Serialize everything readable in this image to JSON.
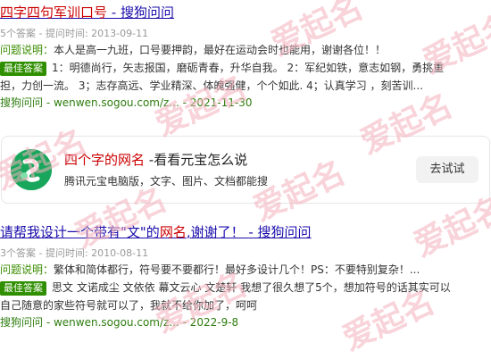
{
  "result1": {
    "title_main": "四字四句军训口号",
    "title_suffix": " - 搜狗问问",
    "meta": "5个答案 - 提问时间: 2013-09-11",
    "question_label": "问题说明：",
    "question_text": "本人是高一九班，口号要押韵，最好在运动会时也能用，谢谢各位！！",
    "best_label": "最佳答案",
    "answer_line1": "1：明德尚行，矢志报国，磨砺青春，升华自我。 2：军纪如铁，意志如钢，勇挑重",
    "answer_line2": "担，力创一流。 3；志存高远、学业精深、体魄强健，个个如此. 4；认真学习 ，刻苦训...",
    "url": "搜狗问问 - wenwen.sogou.com/z... - 2021-11-30"
  },
  "card": {
    "title_hl": "四个字的网名",
    "title_rest": " -看看元宝怎么说",
    "subtitle": "腾讯元宝电脑版，文字、图片、文档都能搜",
    "button": "去试试"
  },
  "result2": {
    "title_a": "请帮我设计一个带有\"文\"的",
    "title_hl": "网名",
    "title_b": ",谢谢了！ - 搜狗问问",
    "meta": "3个答案 - 提问时间: 2010-08-11",
    "question_label": "问题说明：",
    "question_text": "繁体和简体都行，符号要不要都行！最好多设计几个！PS：不要特别复杂！...",
    "best_label": "最佳答案",
    "answer_line1": "思文 文诺成尘 文依依 幕文云心 文楚轩 我想了很久想了5个，想加符号的话其实可以",
    "answer_line2": "自己随意的家些符号就可以了，我就不给你加了，呵呵",
    "url": "搜狗问问 - wenwen.sogou.com/z... - 2022-9-8"
  },
  "watermark": "爱起名",
  "colors": {
    "link": "#1a0dab",
    "highlight": "#c00000",
    "green": "#2f8f00",
    "watermark": "#f3b1bd"
  }
}
